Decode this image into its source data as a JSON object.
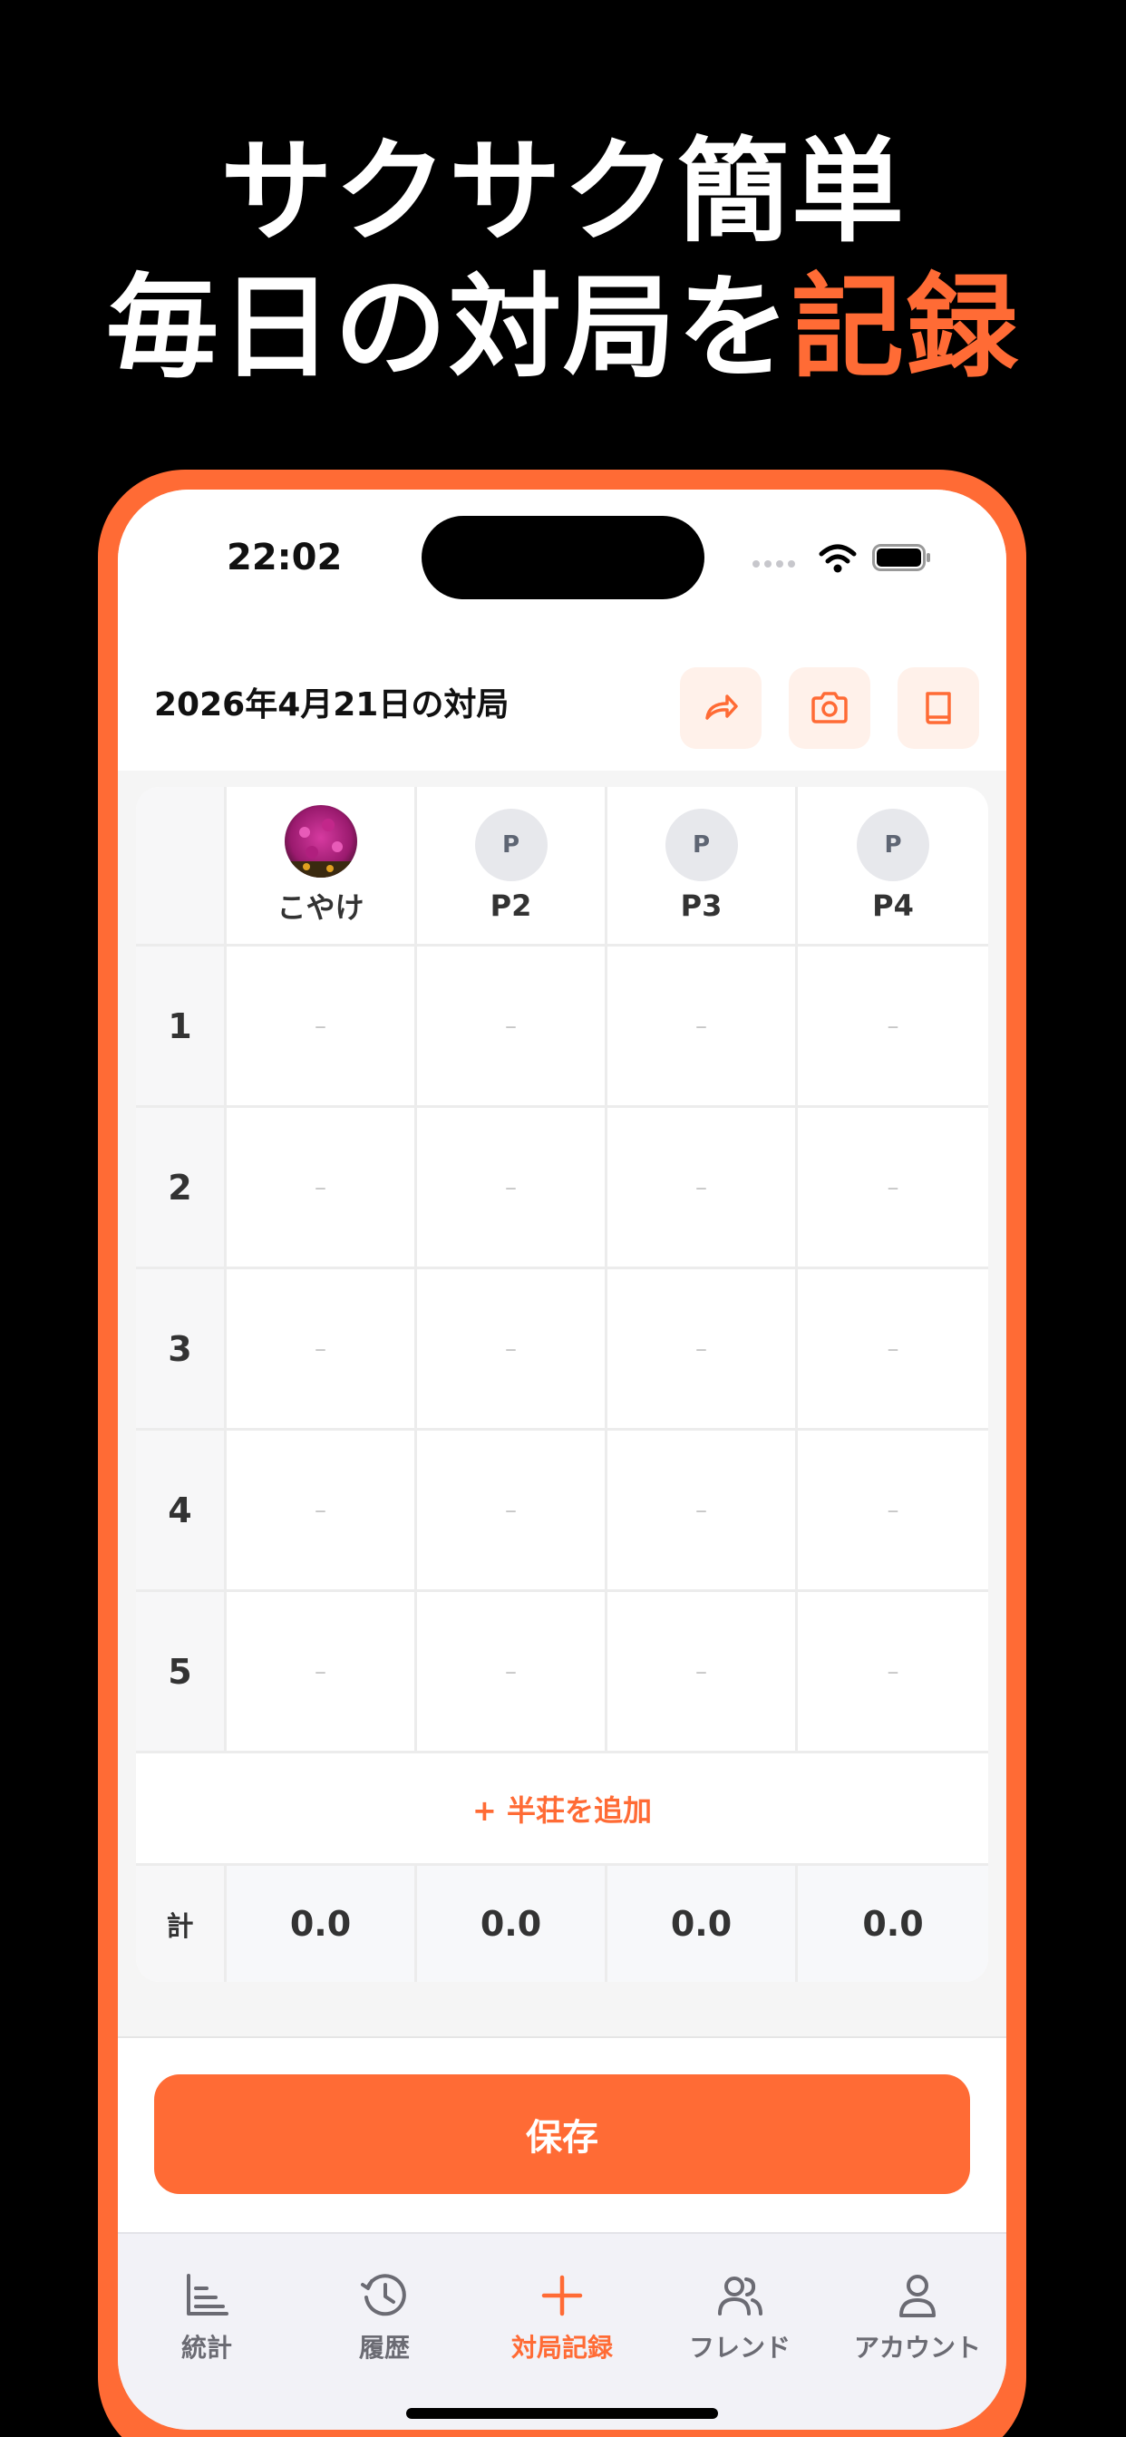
{
  "promo": {
    "line1": "サクサク簡単",
    "line2_prefix": "毎日の対局を",
    "line2_accent": "記録"
  },
  "status": {
    "time": "22:02"
  },
  "header": {
    "title": "2026年4月21日の対局",
    "share_icon": "share-icon",
    "camera_icon": "camera-icon",
    "book_icon": "book-icon"
  },
  "players": [
    {
      "name": "こやけ",
      "avatar": "photo"
    },
    {
      "name": "P2",
      "initial": "P"
    },
    {
      "name": "P3",
      "initial": "P"
    },
    {
      "name": "P4",
      "initial": "P"
    }
  ],
  "rounds": [
    {
      "num": "1",
      "scores": [
        "–",
        "–",
        "–",
        "–"
      ]
    },
    {
      "num": "2",
      "scores": [
        "–",
        "–",
        "–",
        "–"
      ]
    },
    {
      "num": "3",
      "scores": [
        "–",
        "–",
        "–",
        "–"
      ]
    },
    {
      "num": "4",
      "scores": [
        "–",
        "–",
        "–",
        "–"
      ]
    },
    {
      "num": "5",
      "scores": [
        "–",
        "–",
        "–",
        "–"
      ]
    }
  ],
  "add_round_label": "+ 半荘を追加",
  "totals": {
    "label": "計",
    "values": [
      "0.0",
      "0.0",
      "0.0",
      "0.0"
    ]
  },
  "save_label": "保存",
  "tabs": [
    {
      "label": "統計",
      "icon": "chart-icon",
      "active": false
    },
    {
      "label": "履歴",
      "icon": "history-icon",
      "active": false
    },
    {
      "label": "対局記録",
      "icon": "plus-icon",
      "active": true
    },
    {
      "label": "フレンド",
      "icon": "friends-icon",
      "active": false
    },
    {
      "label": "アカウント",
      "icon": "account-icon",
      "active": false
    }
  ],
  "colors": {
    "accent": "#FF6B35",
    "accent_light": "#FFF1EA",
    "background": "#000000"
  }
}
